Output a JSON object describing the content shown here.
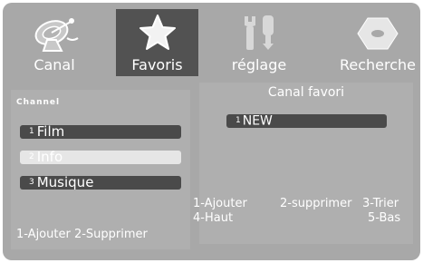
{
  "menu": {
    "items": [
      {
        "label": "Canal",
        "icon": "satellite-dish-icon"
      },
      {
        "label": "Favoris",
        "icon": "star-icon",
        "active": true
      },
      {
        "label": "réglage",
        "icon": "tools-icon"
      },
      {
        "label": "Recherche",
        "icon": "disc-icon"
      }
    ]
  },
  "channel_panel": {
    "header": "Channel",
    "items": [
      {
        "num": "1",
        "label": "Film"
      },
      {
        "num": "2",
        "label": "Info",
        "selected": true
      },
      {
        "num": "3",
        "label": "Musique"
      }
    ],
    "hint": "1-Ajouter 2-Supprimer"
  },
  "favorite_panel": {
    "title": "Canal favori",
    "items": [
      {
        "num": "1",
        "label": "NEW"
      }
    ],
    "hint_line1_left": "1-Ajouter",
    "hint_line1_mid": "2-supprimer",
    "hint_line1_right": "3-Trier",
    "hint_line2_left": "4-Haut",
    "hint_line2_right": "5-Bas"
  },
  "colors": {
    "background": "#a8a8a8",
    "active_tab": "#525252",
    "list_item": "#4a4a4a",
    "selected_item": "#e6e6e6",
    "text": "#ffffff"
  }
}
